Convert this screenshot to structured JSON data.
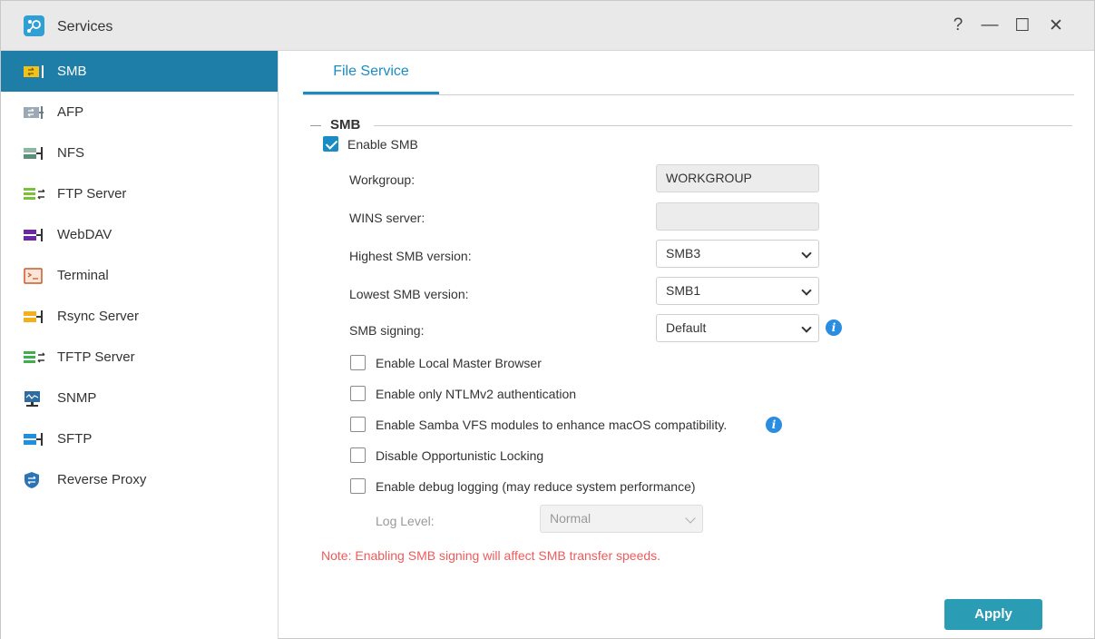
{
  "window": {
    "title": "Services"
  },
  "titlebar_controls": {
    "help": "?",
    "minimize": "—",
    "maximize": "☐",
    "close": "✕"
  },
  "sidebar": {
    "items": [
      {
        "label": "SMB",
        "icon": "smb-icon",
        "active": true
      },
      {
        "label": "AFP",
        "icon": "afp-icon"
      },
      {
        "label": "NFS",
        "icon": "nfs-icon"
      },
      {
        "label": "FTP Server",
        "icon": "ftp-icon"
      },
      {
        "label": "WebDAV",
        "icon": "webdav-icon"
      },
      {
        "label": "Terminal",
        "icon": "terminal-icon"
      },
      {
        "label": "Rsync Server",
        "icon": "rsync-icon"
      },
      {
        "label": "TFTP Server",
        "icon": "tftp-icon"
      },
      {
        "label": "SNMP",
        "icon": "snmp-icon"
      },
      {
        "label": "SFTP",
        "icon": "sftp-icon"
      },
      {
        "label": "Reverse Proxy",
        "icon": "shield-icon"
      }
    ]
  },
  "main": {
    "tab": "File Service",
    "section": "SMB",
    "enable_smb": {
      "label": "Enable SMB",
      "checked": true
    },
    "workgroup": {
      "label": "Workgroup:",
      "value": "WORKGROUP"
    },
    "wins": {
      "label": "WINS server:",
      "value": ""
    },
    "highest": {
      "label": "Highest SMB version:",
      "value": "SMB3"
    },
    "lowest": {
      "label": "Lowest SMB version:",
      "value": "SMB1"
    },
    "signing": {
      "label": "SMB signing:",
      "value": "Default"
    },
    "options": [
      {
        "label": "Enable Local Master Browser",
        "checked": false
      },
      {
        "label": "Enable only NTLMv2 authentication",
        "checked": false
      },
      {
        "label": "Enable Samba VFS modules to enhance macOS compatibility.",
        "checked": false
      },
      {
        "label": "Disable Opportunistic Locking",
        "checked": false
      },
      {
        "label": "Enable debug logging (may reduce system performance)",
        "checked": false
      }
    ],
    "log_level": {
      "label": "Log Level:",
      "value": "Normal"
    },
    "note": "Note: Enabling SMB signing will affect SMB transfer speeds.",
    "apply": "Apply"
  },
  "colors": {
    "accent": "#1f7ea7",
    "tab": "#1a8cc4",
    "apply": "#2a9cb3",
    "note": "#f05a5a",
    "info": "#2a8de0"
  }
}
